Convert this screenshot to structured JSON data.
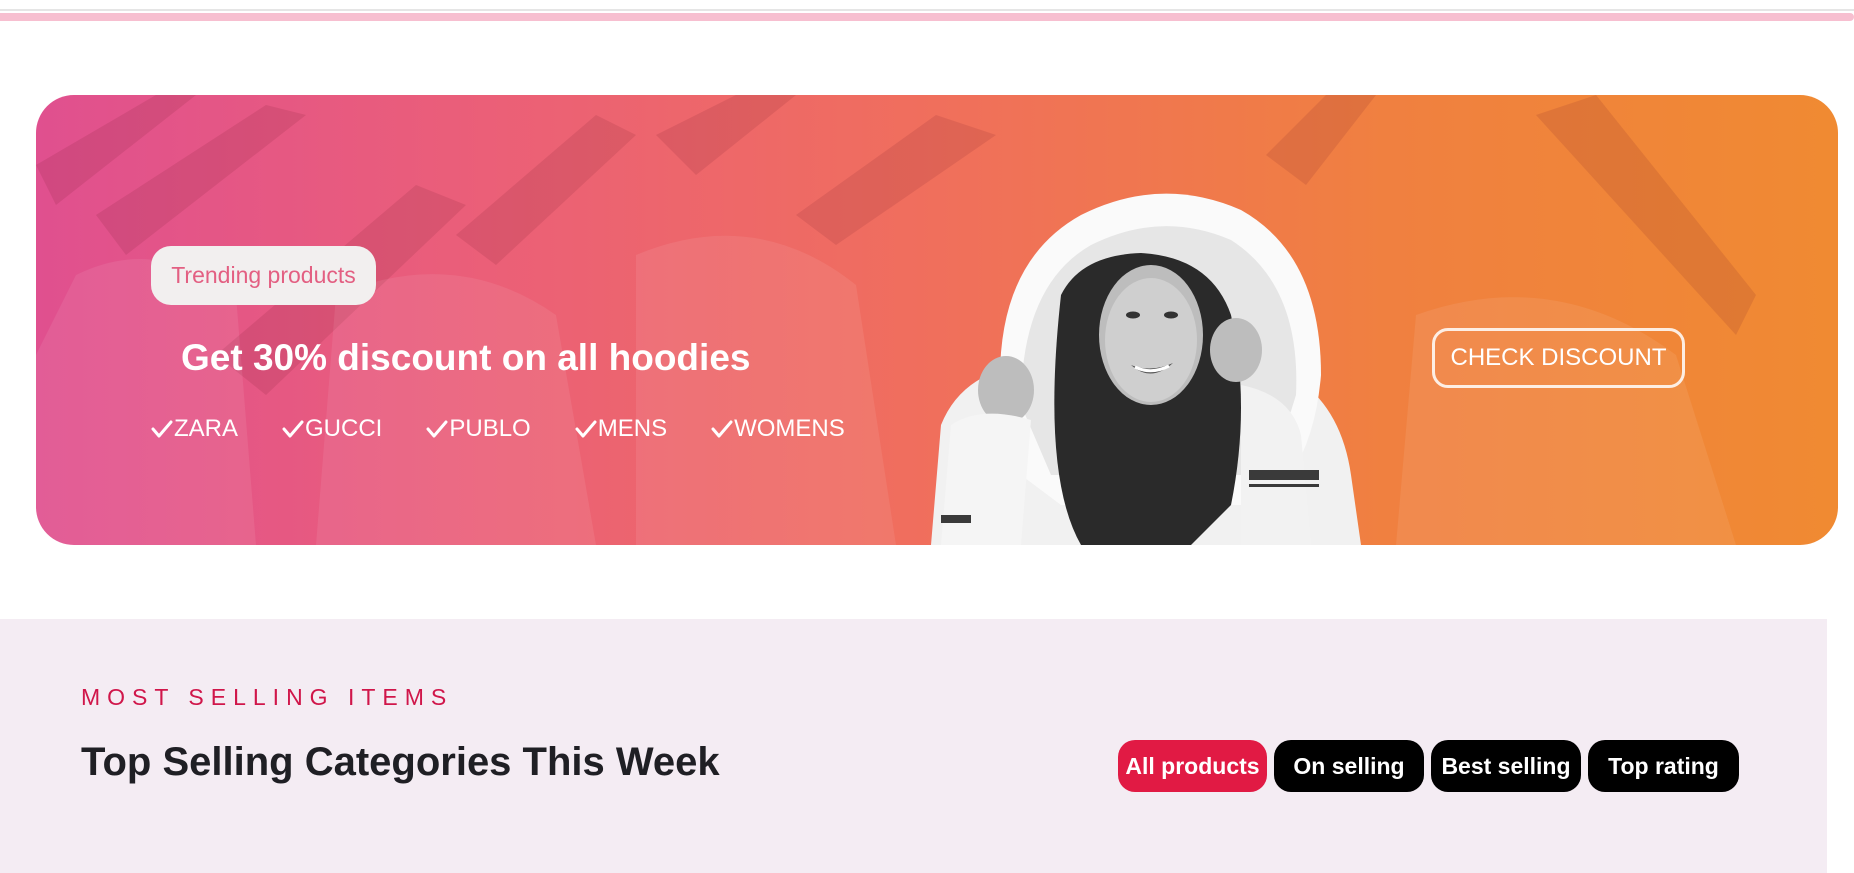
{
  "banner": {
    "pill_label": "Trending products",
    "headline": "Get 30% discount on all hoodies",
    "brands": [
      "ZARA",
      "GUCCI",
      "PUBLO",
      "MENS",
      "WOMENS"
    ],
    "cta_label": "CHECK DISCOUNT",
    "colors": {
      "gradient_start": "#e0508f",
      "gradient_end": "#f08a32"
    }
  },
  "selling": {
    "eyebrow": "MOST SELLING ITEMS",
    "title": "Top Selling Categories This Week",
    "filters": [
      {
        "label": "All products",
        "active": true
      },
      {
        "label": "On selling",
        "active": false
      },
      {
        "label": "Best selling",
        "active": false
      },
      {
        "label": "Top rating",
        "active": false
      }
    ],
    "colors": {
      "accent": "#d0164a",
      "active_filter": "#e11a44",
      "background": "#f4ecf3"
    }
  }
}
